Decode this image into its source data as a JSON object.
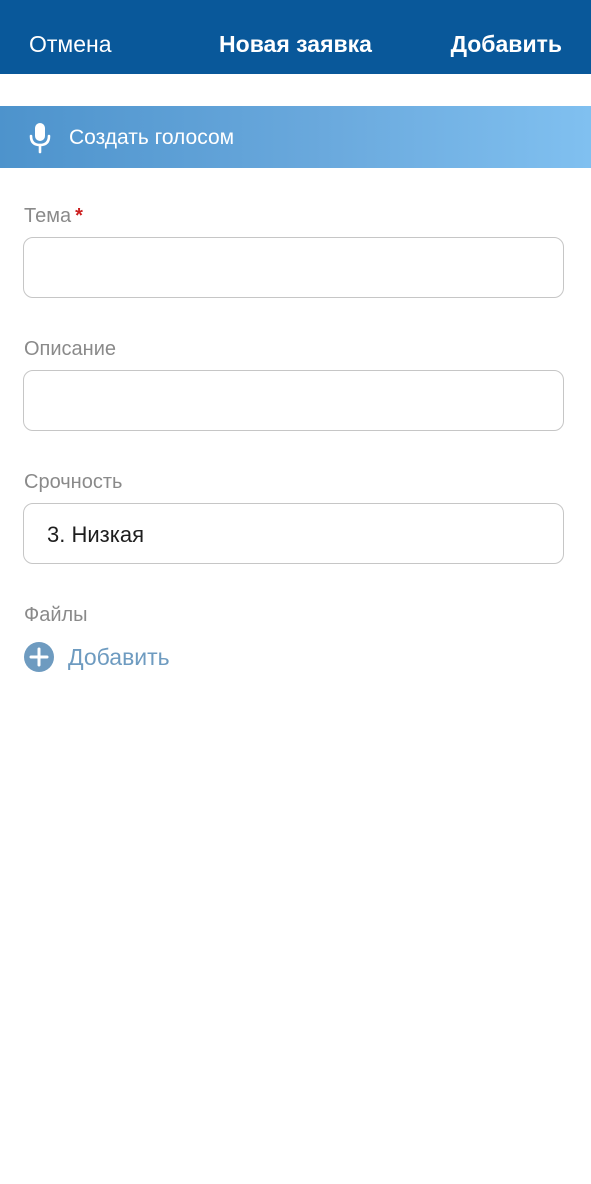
{
  "navbar": {
    "cancel_label": "Отмена",
    "title": "Новая заявка",
    "add_label": "Добавить"
  },
  "voice": {
    "label": "Создать голосом",
    "icon": "microphone-icon"
  },
  "form": {
    "subject": {
      "label": "Тема",
      "required_mark": "*",
      "value": ""
    },
    "description": {
      "label": "Описание",
      "value": ""
    },
    "urgency": {
      "label": "Срочность",
      "selected": "3. Низкая"
    },
    "files": {
      "label": "Файлы",
      "add_label": "Добавить",
      "icon": "plus-circle-icon"
    }
  },
  "colors": {
    "navbar_bg": "#09589a",
    "banner_start": "#4d93cc",
    "banner_end": "#80c0f0",
    "required": "#cc1f1f",
    "link": "#6e9bc0",
    "label": "#8a8a8a"
  }
}
